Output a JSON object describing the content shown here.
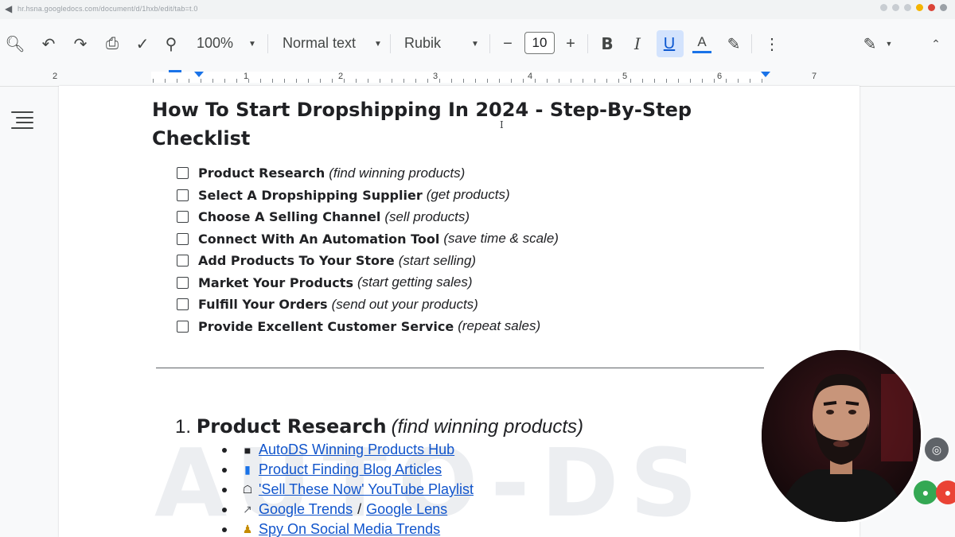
{
  "browser": {
    "url": "hr.hsna.googledocs.com/document/d/1hxb/edit/tab=t.0"
  },
  "toolbar": {
    "zoom": "100%",
    "style": "Normal text",
    "font": "Rubik",
    "font_size": "10",
    "bold": "B",
    "italic": "I",
    "underline": "U",
    "text_color": "A"
  },
  "ruler": {
    "numbers": [
      "2",
      "1",
      "2",
      "3",
      "4",
      "5",
      "6",
      "7"
    ]
  },
  "document": {
    "title": "How To Start Dropshipping In 2024 - Step-By-Step Checklist",
    "checklist": [
      {
        "bold": "Product Research",
        "italic": "(find winning products)"
      },
      {
        "bold": "Select A Dropshipping Supplier",
        "italic": "(get products)"
      },
      {
        "bold": "Choose A Selling Channel",
        "italic": "(sell products)"
      },
      {
        "bold": "Connect With An Automation Tool",
        "italic": "(save time & scale)"
      },
      {
        "bold": "Add Products To Your Store",
        "italic": "(start selling)"
      },
      {
        "bold": "Market Your Products",
        "italic": "(start getting sales)"
      },
      {
        "bold": "Fulfill Your Orders",
        "italic": "(send out your products)"
      },
      {
        "bold": "Provide Excellent Customer Service",
        "italic": "(repeat sales)"
      }
    ],
    "section": {
      "number": "1.",
      "bold": "Product Research",
      "italic": "(find winning products)"
    },
    "links": [
      {
        "icon": "■",
        "text": "AutoDS Winning Products Hub"
      },
      {
        "icon": "▮",
        "text": "Product Finding Blog Articles"
      },
      {
        "icon": "☖",
        "text": "'Sell These Now' YouTube Playlist"
      },
      {
        "icon": "↗",
        "text": "Google Trends",
        "slash": "/",
        "text2": "Google Lens"
      },
      {
        "icon": "♟",
        "text": "Spy On Social Media Trends"
      }
    ],
    "watermark": "AutoDS"
  },
  "colors": {
    "link": "#1155cc",
    "accent": "#1a73e8",
    "underline_active": "#d3e3fd"
  }
}
